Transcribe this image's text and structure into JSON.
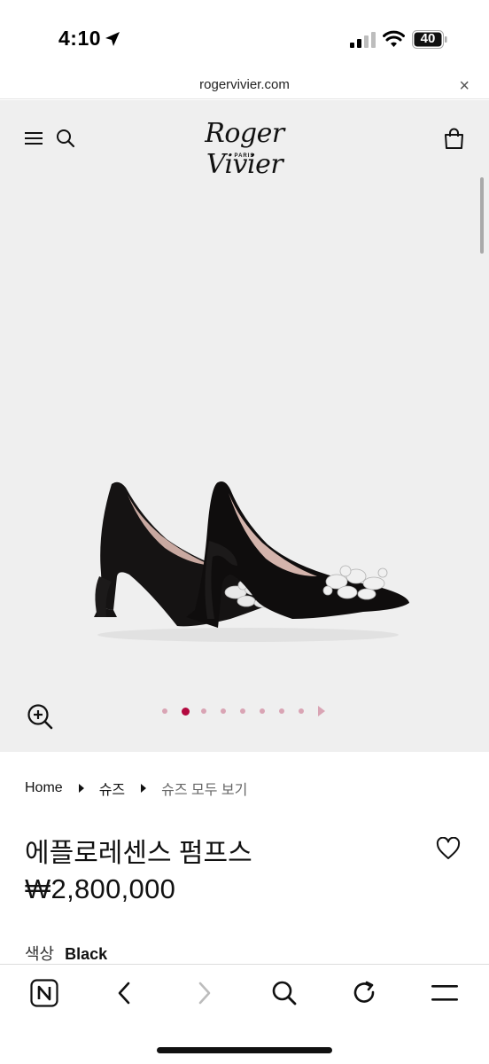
{
  "status_bar": {
    "time": "4:10",
    "battery": "40",
    "icons": [
      "location-arrow-icon",
      "cellular-signal-icon",
      "wifi-icon",
      "battery-icon"
    ]
  },
  "browser": {
    "url": "rogervivier.com",
    "close_glyph": "×",
    "toolbar_icons": [
      "naver-home-icon",
      "back-icon",
      "forward-icon",
      "search-icon",
      "reload-icon",
      "menu-icon"
    ]
  },
  "header": {
    "logo_text": "Roger Vivier",
    "logo_sub": "PARIS",
    "icons": [
      "hamburger-menu-icon",
      "search-icon",
      "shopping-bag-icon"
    ]
  },
  "gallery": {
    "slide_count": 8,
    "active_index": 1,
    "colors": {
      "active_dot": "#b3093f",
      "inactive_dot": "#d9a4b4",
      "background": "#efefef"
    }
  },
  "breadcrumb": {
    "items": [
      "Home",
      "슈즈",
      "슈즈 모두 보기"
    ]
  },
  "product": {
    "title": "에플로레센스 펌프스",
    "price": "₩2,800,000",
    "color_label": "색상",
    "color_value": "Black"
  }
}
